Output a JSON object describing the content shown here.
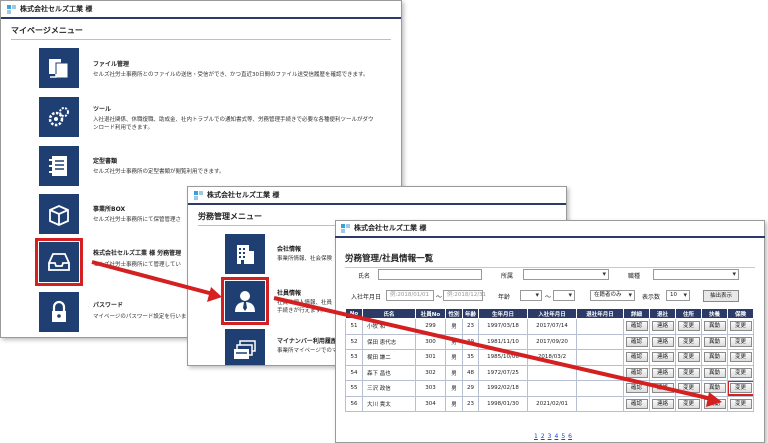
{
  "company": "株式会社セルズ工業 様",
  "panel1": {
    "menu_title": "マイページメニュー",
    "items": [
      {
        "title": "ファイル管理",
        "desc": [
          "セルズ社労士事務所とのファイルの送信・受信ができ、かつ直近30日間のファイル送受信履歴を確認できます。"
        ],
        "icon": "file-transfer-icon"
      },
      {
        "title": "ツール",
        "desc": [
          "入社退社関係、休職復職、助成金、社内トラブルでの通知書式等、労務管理手続きで必要な各種便利ツールがダウ",
          "ンロード利用できます。"
        ],
        "icon": "gears-icon"
      },
      {
        "title": "定型書類",
        "desc": [
          "セルズ社労士事務所の定型書類が閲覧利用できます。"
        ],
        "icon": "notebook-icon"
      },
      {
        "title": "事業所BOX",
        "desc": [
          "セルズ社労士事務所にて保管管理さ"
        ],
        "icon": "box-icon"
      },
      {
        "title": "株式会社セルズ工業 様 労務管理",
        "desc": [
          "セルズ社労士事務所にて管理してい"
        ],
        "icon": "inbox-tray-icon"
      },
      {
        "title": "パスワード",
        "desc": [
          "マイページのパスワード設定を行いま"
        ],
        "icon": "lock-icon"
      }
    ]
  },
  "panel2": {
    "menu_title": "労務管理メニュー",
    "items": [
      {
        "title": "会社情報",
        "desc": [
          "事業所情報、社会保険"
        ],
        "icon": "building-icon"
      },
      {
        "title": "社員情報",
        "desc": [
          "社員の個人情報、社員",
          "手続きが行えます。"
        ],
        "icon": "employee-icon"
      },
      {
        "title": "マイナンバー利用履歴",
        "desc": [
          "事業所マイページでのマ"
        ],
        "icon": "cards-icon"
      }
    ]
  },
  "panel3": {
    "page_title": "労務管理/社員情報一覧",
    "filters": {
      "name_label": "氏名",
      "affiliation_label": "所属",
      "job_label": "職種",
      "hire_date_label": "入社年月日",
      "hire_from_placeholder": "例:2018/01/01",
      "range_sep": "〜",
      "hire_to_placeholder": "例:2018/12/31",
      "age_label": "年齢",
      "age_sep": "〜",
      "status_value": "在籍者のみ",
      "per_page_label": "表示数",
      "per_page_value": "10",
      "extract_button": "抽出表示"
    },
    "columns": [
      "No",
      "氏名",
      "社員No",
      "性別",
      "年齢",
      "生年月日",
      "入社年月日",
      "退社年月日",
      "詳細",
      "退社",
      "住所",
      "扶養",
      "保険"
    ],
    "rows": [
      {
        "no": "51",
        "name": "小牧 和",
        "emp_no": "299",
        "sex": "男",
        "age": "23",
        "birth": "1997/03/18",
        "hired": "2017/07/14",
        "left": ""
      },
      {
        "no": "52",
        "name": "保田 恵代志",
        "emp_no": "300",
        "sex": "男",
        "age": "39",
        "birth": "1981/11/10",
        "hired": "2017/09/20",
        "left": ""
      },
      {
        "no": "53",
        "name": "梶田 謙二",
        "emp_no": "301",
        "sex": "男",
        "age": "35",
        "birth": "1985/10/06",
        "hired": "2018/03/2",
        "left": ""
      },
      {
        "no": "54",
        "name": "森下 昌也",
        "emp_no": "302",
        "sex": "男",
        "age": "48",
        "birth": "1972/07/25",
        "hired": "",
        "left": ""
      },
      {
        "no": "55",
        "name": "三沢 政信",
        "emp_no": "303",
        "sex": "男",
        "age": "29",
        "birth": "1992/02/18",
        "hired": "",
        "left": ""
      },
      {
        "no": "56",
        "name": "大川 貴太",
        "emp_no": "304",
        "sex": "男",
        "age": "23",
        "birth": "1998/01/30",
        "hired": "2021/02/01",
        "left": ""
      }
    ],
    "btn_detail": "確認",
    "btn_retire": "連絡",
    "btn_address": "変更",
    "btn_dependent": "異動",
    "btn_insurance": "変更",
    "pages": [
      "1",
      "2",
      "3",
      "4",
      "5",
      "6"
    ]
  },
  "colors": {
    "navy": "#1f3f73",
    "header_navy": "#2b3a67",
    "highlight_red": "#d42020",
    "link_blue": "#1b46c8"
  }
}
